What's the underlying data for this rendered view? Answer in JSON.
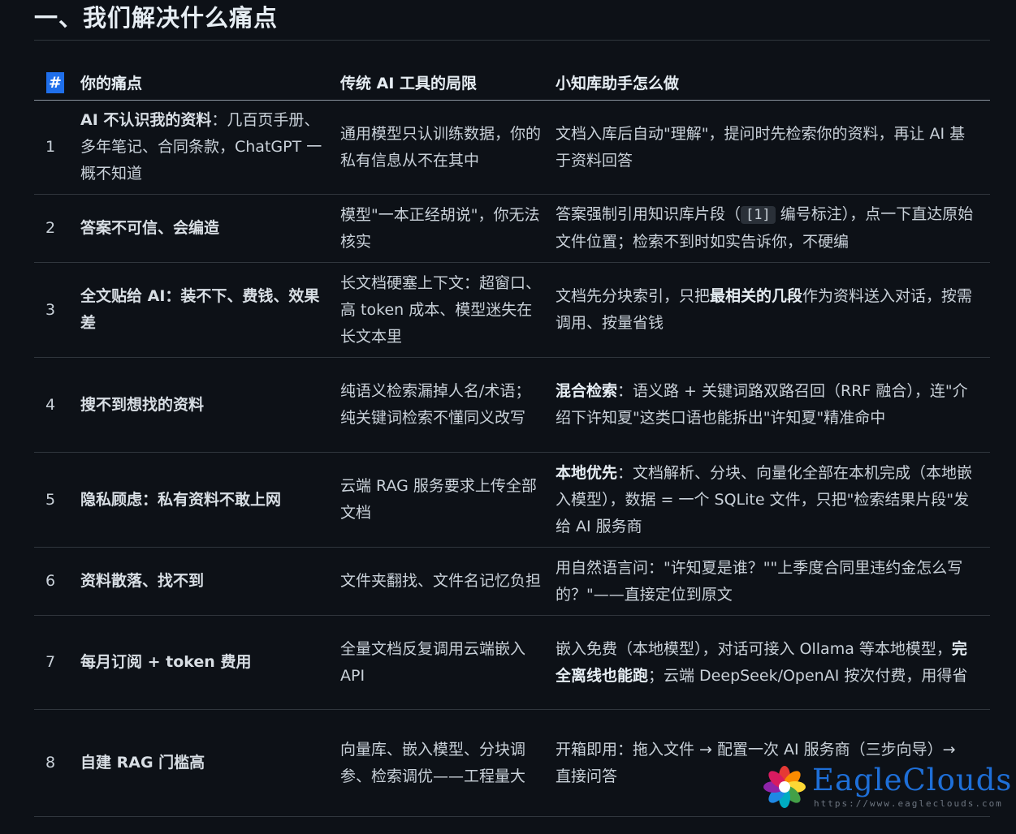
{
  "heading": "一、我们解决什么痛点",
  "table": {
    "headers": [
      "#",
      "你的痛点",
      "传统 AI 工具的局限",
      "小知库助手怎么做"
    ],
    "rows": [
      {
        "num": "1",
        "pain_bold": "AI 不认识我的资料",
        "pain_rest": "：几百页手册、多年笔记、合同条款，ChatGPT 一概不知道",
        "limit": "通用模型只认训练数据，你的私有信息从不在其中",
        "solution": "文档入库后自动\"理解\"，提问时先检索你的资料，再让 AI 基于资料回答"
      },
      {
        "num": "2",
        "pain": "答案不可信、会编造",
        "limit": "模型\"一本正经胡说\"，你无法核实",
        "solution_pre": "答案强制引用知识库片段（",
        "solution_code": "[1]",
        "solution_post": " 编号标注），点一下直达原始文件位置；检索不到时如实告诉你，不硬编"
      },
      {
        "num": "3",
        "pain": "全文贴给 AI：装不下、费钱、效果差",
        "limit": "长文档硬塞上下文：超窗口、高 token 成本、模型迷失在长文本里",
        "solution_pre": "文档先分块索引，只把",
        "solution_bold": "最相关的几段",
        "solution_post": "作为资料送入对话，按需调用、按量省钱"
      },
      {
        "num": "4",
        "pain": "搜不到想找的资料",
        "limit": "纯语义检索漏掉人名/术语；纯关键词检索不懂同义改写",
        "solution_bold": "混合检索",
        "solution_post": "：语义路 + 关键词路双路召回（RRF 融合），连\"介绍下许知夏\"这类口语也能拆出\"许知夏\"精准命中"
      },
      {
        "num": "5",
        "pain": "隐私顾虑：私有资料不敢上网",
        "limit": "云端 RAG 服务要求上传全部文档",
        "solution_bold": "本地优先",
        "solution_post": "：文档解析、分块、向量化全部在本机完成（本地嵌入模型），数据 = 一个 SQLite 文件，只把\"检索结果片段\"发给 AI 服务商"
      },
      {
        "num": "6",
        "pain": "资料散落、找不到",
        "limit": "文件夹翻找、文件名记忆负担",
        "solution": "用自然语言问：\"许知夏是谁？\"\"上季度合同里违约金怎么写的？\"——直接定位到原文"
      },
      {
        "num": "7",
        "pain": "每月订阅 + token 费用",
        "limit": "全量文档反复调用云端嵌入 API",
        "solution_pre": "嵌入免费（本地模型），对话可接入 Ollama 等本地模型，",
        "solution_bold": "完全离线也能跑",
        "solution_post": "；云端 DeepSeek/OpenAI 按次付费，用得省"
      },
      {
        "num": "8",
        "pain": "自建 RAG 门槛高",
        "limit": "向量库、嵌入模型、分块调参、检索调优——工程量大",
        "solution": "开箱即用：拖入文件 → 配置一次 AI 服务商（三步向导）→ 直接问答"
      }
    ]
  },
  "watermark": {
    "brand": "EagleClouds",
    "url": "https://www.eagleclouds.com",
    "icon": "flower-logo-icon"
  }
}
